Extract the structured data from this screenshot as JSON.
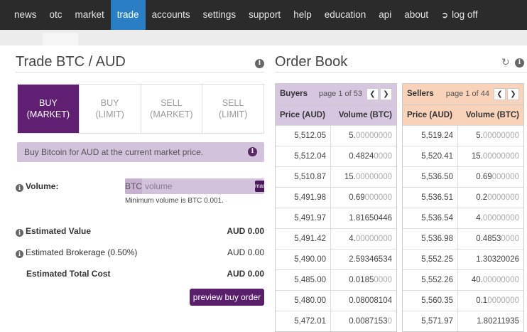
{
  "nav": {
    "items": [
      {
        "label": "news",
        "active": false
      },
      {
        "label": "otc",
        "active": false
      },
      {
        "label": "market",
        "active": false
      },
      {
        "label": "trade",
        "active": true
      },
      {
        "label": "accounts",
        "active": false
      },
      {
        "label": "settings",
        "active": false
      },
      {
        "label": "support",
        "active": false
      },
      {
        "label": "help",
        "active": false
      },
      {
        "label": "education",
        "active": false
      },
      {
        "label": "api",
        "active": false
      },
      {
        "label": "about",
        "active": false
      }
    ],
    "logoff_label": "log off"
  },
  "trade": {
    "title": "Trade BTC / AUD",
    "tabs": [
      {
        "line1": "BUY",
        "line2": "(MARKET)",
        "active": true
      },
      {
        "line1": "BUY",
        "line2": "(LIMIT)",
        "active": false
      },
      {
        "line1": "SELL",
        "line2": "(MARKET)",
        "active": false
      },
      {
        "line1": "SELL",
        "line2": "(LIMIT)",
        "active": false
      }
    ],
    "description": "Buy Bitcoin for AUD at the current market price.",
    "volume_label": "Volume:",
    "volume_currency": "BTC",
    "volume_placeholder": "volume",
    "max_label": "max",
    "min_hint": "Minimum volume is BTC 0.001.",
    "estimated_value_label": "Estimated Value",
    "estimated_value": "AUD 0.00",
    "brokerage_label": "Estimated Brokerage (0.50%)",
    "brokerage_value": "AUD 0.00",
    "total_label": "Estimated Total Cost",
    "total_value": "AUD 0.00",
    "preview_button": "preview buy order"
  },
  "order_book": {
    "title": "Order Book",
    "buyers": {
      "label": "Buyers",
      "page": "page 1 of 53",
      "col_price": "Price (AUD)",
      "col_volume": "Volume (BTC)",
      "rows": [
        {
          "price": "5,512.05",
          "vol_main": "5.",
          "vol_zeros": "00000000"
        },
        {
          "price": "5,512.04",
          "vol_main": "0.4824",
          "vol_zeros": "0000"
        },
        {
          "price": "5,510.87",
          "vol_main": "15.",
          "vol_zeros": "00000000"
        },
        {
          "price": "5,491.98",
          "vol_main": "0.69",
          "vol_zeros": "000000"
        },
        {
          "price": "5,491.97",
          "vol_main": "1.81650446",
          "vol_zeros": ""
        },
        {
          "price": "5,491.42",
          "vol_main": "4.",
          "vol_zeros": "00000000"
        },
        {
          "price": "5,490.00",
          "vol_main": "2.59346534",
          "vol_zeros": ""
        },
        {
          "price": "5,485.00",
          "vol_main": "0.0185",
          "vol_zeros": "0000"
        },
        {
          "price": "5,480.00",
          "vol_main": "0.08008104",
          "vol_zeros": ""
        },
        {
          "price": "5,472.01",
          "vol_main": "0.0087153",
          "vol_zeros": "0"
        }
      ]
    },
    "sellers": {
      "label": "Sellers",
      "page": "page 1 of 44",
      "col_price": "Price (AUD)",
      "col_volume": "Volume (BTC)",
      "rows": [
        {
          "price": "5,519.24",
          "vol_main": "5.",
          "vol_zeros": "00000000"
        },
        {
          "price": "5,520.41",
          "vol_main": "15.",
          "vol_zeros": "00000000"
        },
        {
          "price": "5,536.50",
          "vol_main": "0.69",
          "vol_zeros": "000000"
        },
        {
          "price": "5,536.51",
          "vol_main": "0.2",
          "vol_zeros": "0000000"
        },
        {
          "price": "5,536.54",
          "vol_main": "4.",
          "vol_zeros": "00000000"
        },
        {
          "price": "5,536.98",
          "vol_main": "0.4853",
          "vol_zeros": "0000"
        },
        {
          "price": "5,552.25",
          "vol_main": "1.30320026",
          "vol_zeros": ""
        },
        {
          "price": "5,552.26",
          "vol_main": "40.",
          "vol_zeros": "00000000"
        },
        {
          "price": "5,560.35",
          "vol_main": "0.1",
          "vol_zeros": "0000000"
        },
        {
          "price": "5,571.97",
          "vol_main": "1.80211935",
          "vol_zeros": ""
        }
      ]
    }
  },
  "colors": {
    "nav_bg": "#2b2b2b",
    "nav_active": "#2a7fc4",
    "brand_purple": "#611f74",
    "buyers_header": "#d6c6e0",
    "sellers_header": "#f8d2b9"
  }
}
